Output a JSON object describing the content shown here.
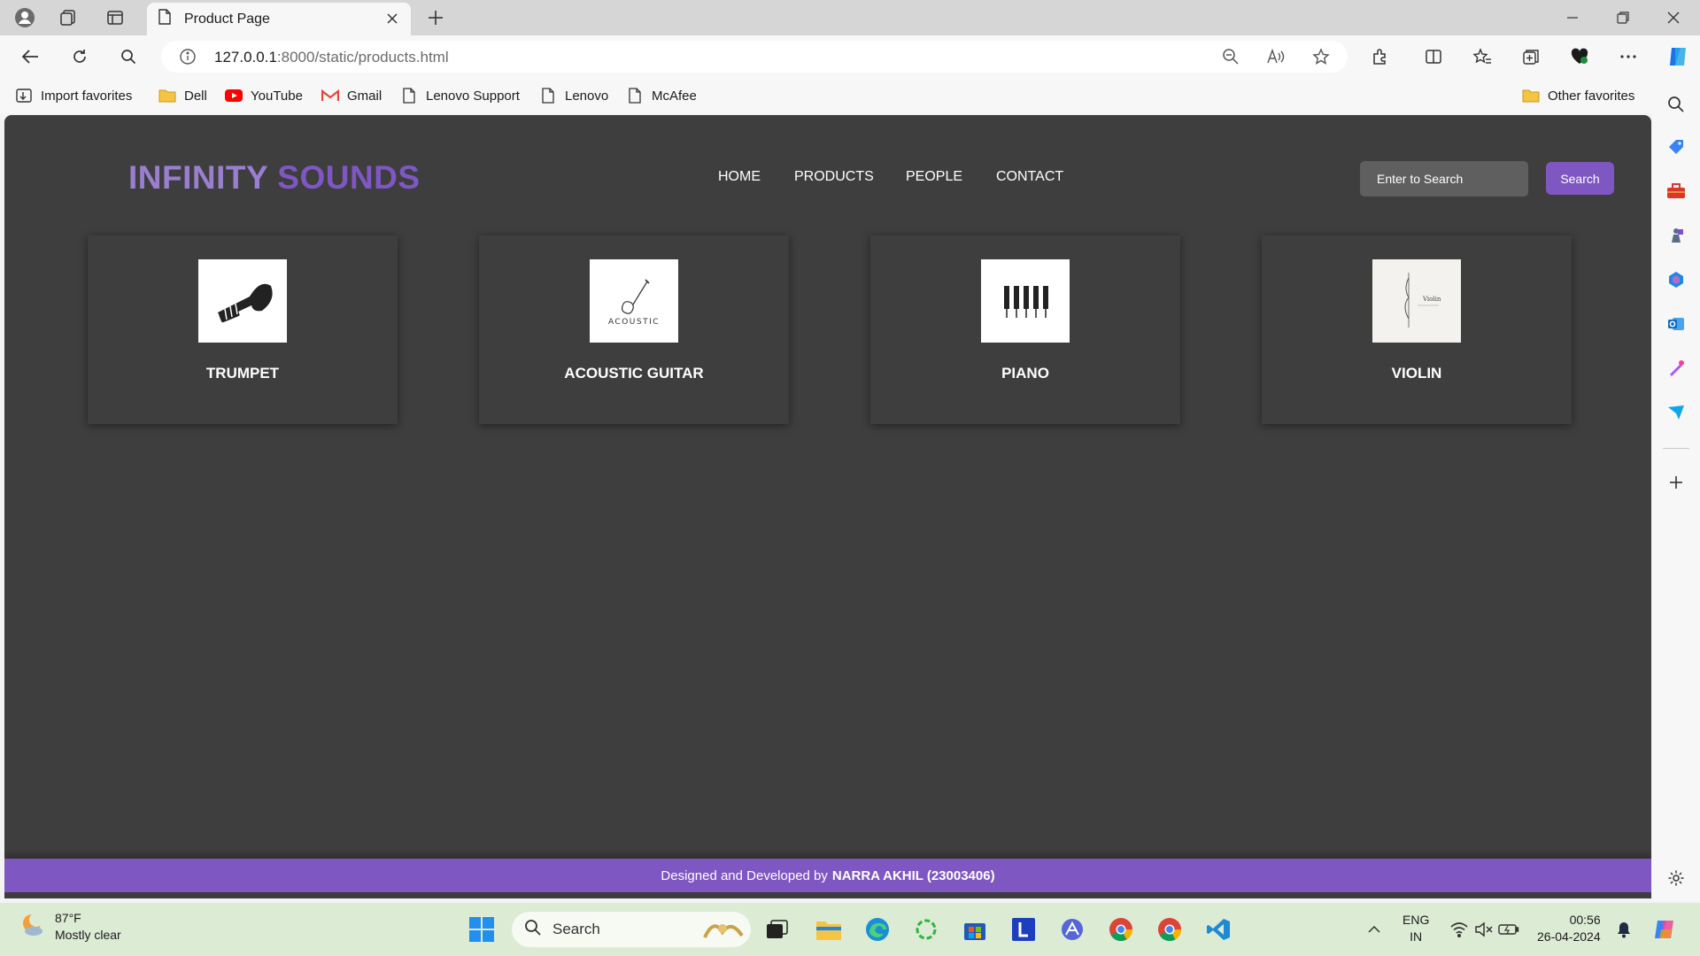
{
  "browser": {
    "tab_title": "Product Page",
    "url_host": "127.0.0.1",
    "url_rest": ":8000/static/products.html",
    "favorites": [
      {
        "label": "Import favorites",
        "icon": "import-icon"
      },
      {
        "label": "Dell",
        "icon": "folder-icon"
      },
      {
        "label": "YouTube",
        "icon": "youtube-icon"
      },
      {
        "label": "Gmail",
        "icon": "gmail-icon"
      },
      {
        "label": "Lenovo Support",
        "icon": "page-icon"
      },
      {
        "label": "Lenovo",
        "icon": "page-icon"
      },
      {
        "label": "McAfee",
        "icon": "page-icon"
      }
    ],
    "other_favorites": "Other favorites"
  },
  "site": {
    "logo_part1": "INFINITY",
    "logo_part2": "SOUNDS",
    "nav": [
      "HOME",
      "PRODUCTS",
      "PEOPLE",
      "CONTACT"
    ],
    "search_placeholder": "Enter to Search",
    "search_button": "Search",
    "products": [
      {
        "name": "TRUMPET",
        "image": "trumpet-image"
      },
      {
        "name": "ACOUSTIC GUITAR",
        "image": "acoustic-guitar-image",
        "image_text": "ACOUSTIC"
      },
      {
        "name": "PIANO",
        "image": "piano-image"
      },
      {
        "name": "VIOLIN",
        "image": "violin-image",
        "image_text": "Violin"
      }
    ],
    "footer_text": "Designed and Developed by",
    "footer_author": "NARRA AKHIL (23003406)",
    "colors": {
      "accent": "#7e57c2",
      "logo_light": "#9a7fd1",
      "background": "#3e3e3e"
    }
  },
  "taskbar": {
    "temperature": "87°F",
    "weather": "Mostly clear",
    "search_label": "Search",
    "lang": "ENG",
    "region": "IN",
    "time": "00:56",
    "date": "26-04-2024"
  }
}
